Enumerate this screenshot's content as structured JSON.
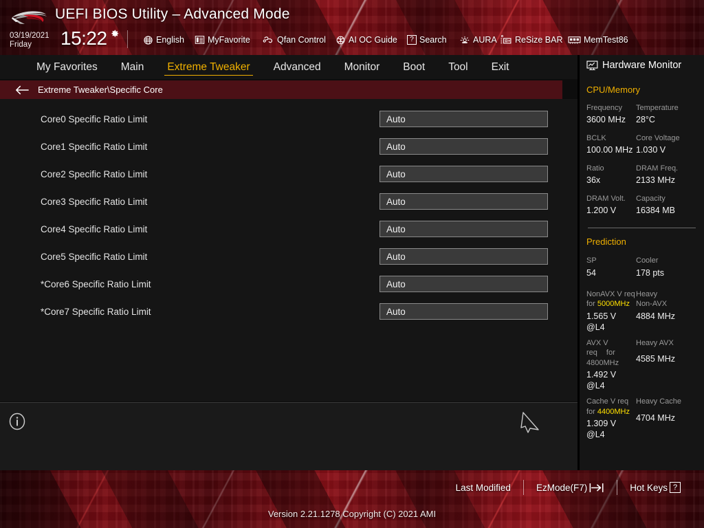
{
  "header": {
    "logo_name": "rog-logo",
    "title": "UEFI BIOS Utility – Advanced Mode",
    "date": "03/19/2021",
    "weekday": "Friday",
    "time": "15:22",
    "gear_icon": "gear-icon",
    "tools": [
      {
        "label": "English",
        "icon": "globe-icon"
      },
      {
        "label": "MyFavorite",
        "icon": "list-document-icon"
      },
      {
        "label": "Qfan Control",
        "icon": "fan-icon"
      },
      {
        "label": "AI OC Guide",
        "icon": "brain-icon"
      },
      {
        "label": "Search",
        "icon": "question-box-icon"
      },
      {
        "label": "AURA",
        "icon": "lighting-icon"
      },
      {
        "label": "ReSize BAR",
        "icon": "resize-bar-icon"
      },
      {
        "label": "MemTest86",
        "icon": "memory-module-icon"
      }
    ]
  },
  "nav": {
    "tabs": [
      {
        "label": "My Favorites",
        "active": false
      },
      {
        "label": "Main",
        "active": false
      },
      {
        "label": "Extreme Tweaker",
        "active": true
      },
      {
        "label": "Advanced",
        "active": false
      },
      {
        "label": "Monitor",
        "active": false
      },
      {
        "label": "Boot",
        "active": false
      },
      {
        "label": "Tool",
        "active": false
      },
      {
        "label": "Exit",
        "active": false
      }
    ],
    "active_color": "#f0b000"
  },
  "breadcrumb": {
    "back_icon": "back-arrow-icon",
    "path": "Extreme Tweaker\\Specific Core"
  },
  "settings": {
    "rows": [
      {
        "label": "Core0 Specific Ratio Limit",
        "value": "Auto"
      },
      {
        "label": "Core1 Specific Ratio Limit",
        "value": "Auto"
      },
      {
        "label": "Core2 Specific Ratio Limit",
        "value": "Auto"
      },
      {
        "label": "Core3 Specific Ratio Limit",
        "value": "Auto"
      },
      {
        "label": "Core4 Specific Ratio Limit",
        "value": "Auto"
      },
      {
        "label": "Core5 Specific Ratio Limit",
        "value": "Auto"
      },
      {
        "label": "*Core6 Specific Ratio Limit",
        "value": "Auto"
      },
      {
        "label": "*Core7 Specific Ratio Limit",
        "value": "Auto"
      }
    ]
  },
  "lower_pane": {
    "info_icon": "info-icon",
    "cursor_icon": "mouse-cursor-icon",
    "help_text": ""
  },
  "sidebar": {
    "title": "Hardware Monitor",
    "title_icon": "monitor-chart-icon",
    "cpu_memory": {
      "heading": "CPU/Memory",
      "pairs": [
        {
          "label": "Frequency",
          "value": "3600 MHz",
          "label2": "Temperature",
          "value2": "28°C"
        },
        {
          "label": "BCLK",
          "value": "100.00 MHz",
          "label2": "Core Voltage",
          "value2": "1.030 V"
        },
        {
          "label": "Ratio",
          "value": "36x",
          "label2": "DRAM Freq.",
          "value2": "2133 MHz"
        },
        {
          "label": "DRAM Volt.",
          "value": "1.200 V",
          "label2": "Capacity",
          "value2": "16384 MB"
        }
      ]
    },
    "prediction": {
      "heading": "Prediction",
      "sp_label": "SP",
      "sp_value": "54",
      "cooler_label": "Cooler",
      "cooler_value": "178 pts",
      "nonavx_label_a": "NonAVX V req",
      "nonavx_label_b_pre": "for ",
      "nonavx_label_b_hi": "5000MHz",
      "nonavx_value": "1.565 V @L4",
      "heavy_nonavx_label_a": "Heavy",
      "heavy_nonavx_label_b": "Non-AVX",
      "heavy_nonavx_value": "4884 MHz",
      "avx_label_a": "AVX V req",
      "avx_label_for": "for",
      "avx_label_hi": "4800MHz",
      "avx_value": "1.492 V @L4",
      "heavy_avx_label": "Heavy AVX",
      "heavy_avx_value": "4585 MHz",
      "cache_label_a": "Cache V req",
      "cache_label_b_pre": "for ",
      "cache_label_b_hi": "4400MHz",
      "cache_value": "1.309 V @L4",
      "heavy_cache_label": "Heavy Cache",
      "heavy_cache_value": "4704 MHz"
    },
    "heading_color": "#f0b000",
    "highlight_color": "#ffe000"
  },
  "footer": {
    "last_modified": "Last Modified",
    "ezmode": "EzMode(F7)",
    "ezmode_icon": "enter-arrow-icon",
    "hotkeys": "Hot Keys",
    "hotkeys_key": "?",
    "version": "Version 2.21.1278 Copyright (C) 2021 AMI"
  }
}
